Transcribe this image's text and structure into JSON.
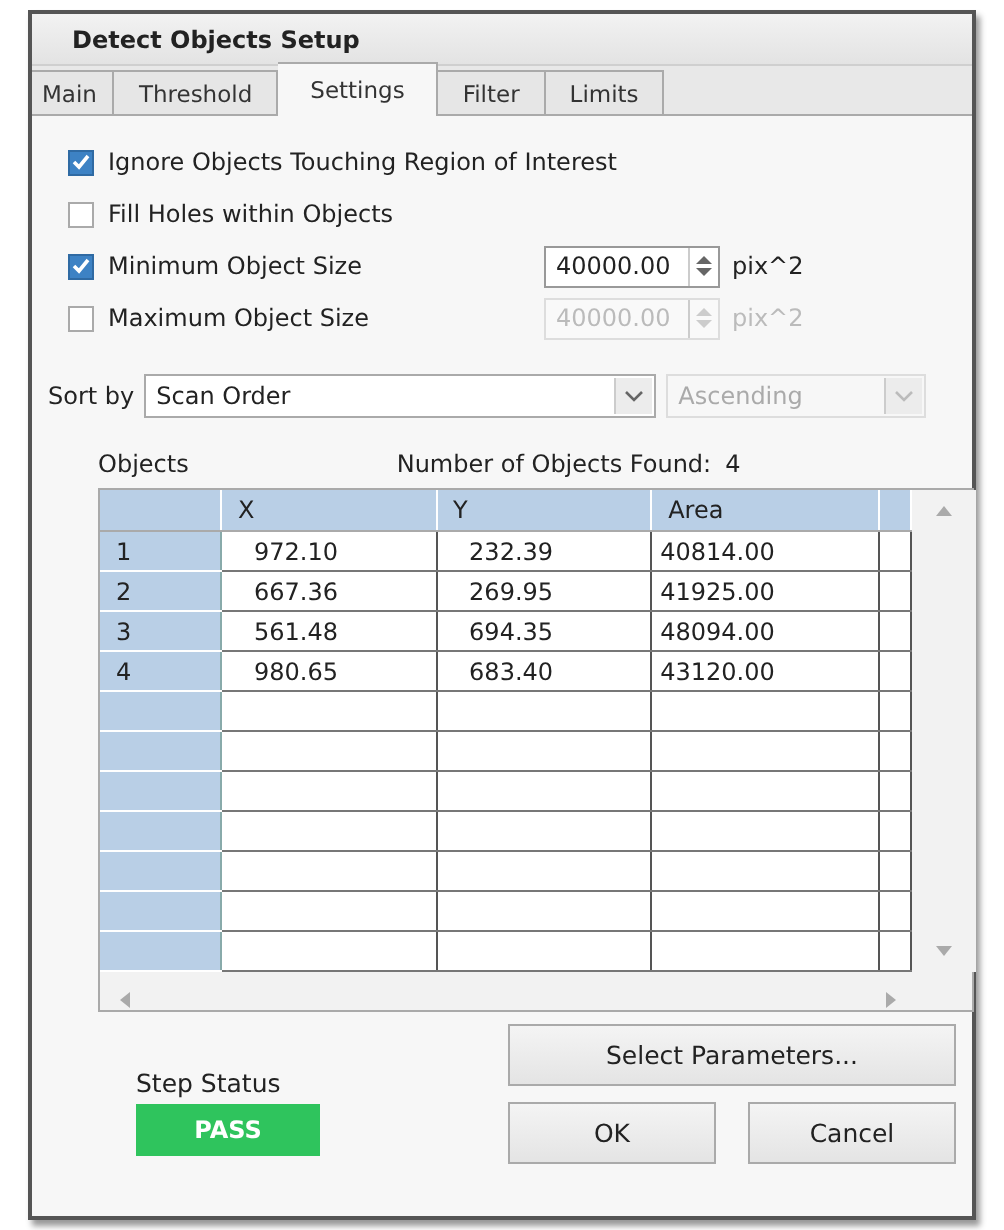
{
  "window": {
    "title": "Detect Objects Setup"
  },
  "tabs": [
    {
      "label": "Main",
      "selected": false
    },
    {
      "label": "Threshold",
      "selected": false
    },
    {
      "label": "Settings",
      "selected": true
    },
    {
      "label": "Filter",
      "selected": false
    },
    {
      "label": "Limits",
      "selected": false
    }
  ],
  "options": [
    {
      "label": "Ignore Objects Touching Region of Interest",
      "checked": true
    },
    {
      "label": "Fill Holes within Objects",
      "checked": false
    },
    {
      "label": "Minimum Object Size",
      "checked": true,
      "field": {
        "value": "40000.00",
        "unit": "pix^2",
        "disabled": false
      }
    },
    {
      "label": "Maximum Object Size",
      "checked": false,
      "field": {
        "value": "40000.00",
        "unit": "pix^2",
        "disabled": true
      }
    }
  ],
  "sort": {
    "label": "Sort by",
    "order_by": {
      "value": "Scan Order",
      "disabled": false
    },
    "direction": {
      "value": "Ascending",
      "disabled": true
    }
  },
  "objects": {
    "label": "Objects",
    "found_label": "Number of Objects Found:",
    "found_count": "4"
  },
  "table": {
    "columns": [
      "X",
      "Y",
      "Area"
    ],
    "rows": [
      {
        "index": "1",
        "cells": [
          "972.10",
          "232.39",
          "40814.00"
        ]
      },
      {
        "index": "2",
        "cells": [
          "667.36",
          "269.95",
          "41925.00"
        ]
      },
      {
        "index": "3",
        "cells": [
          "561.48",
          "694.35",
          "48094.00"
        ]
      },
      {
        "index": "4",
        "cells": [
          "980.65",
          "683.40",
          "43120.00"
        ]
      }
    ]
  },
  "step_status": {
    "label": "Step Status",
    "result": "PASS",
    "passed": true
  },
  "buttons": {
    "select": "Select Parameters...",
    "ok": "OK",
    "cancel": "Cancel"
  }
}
